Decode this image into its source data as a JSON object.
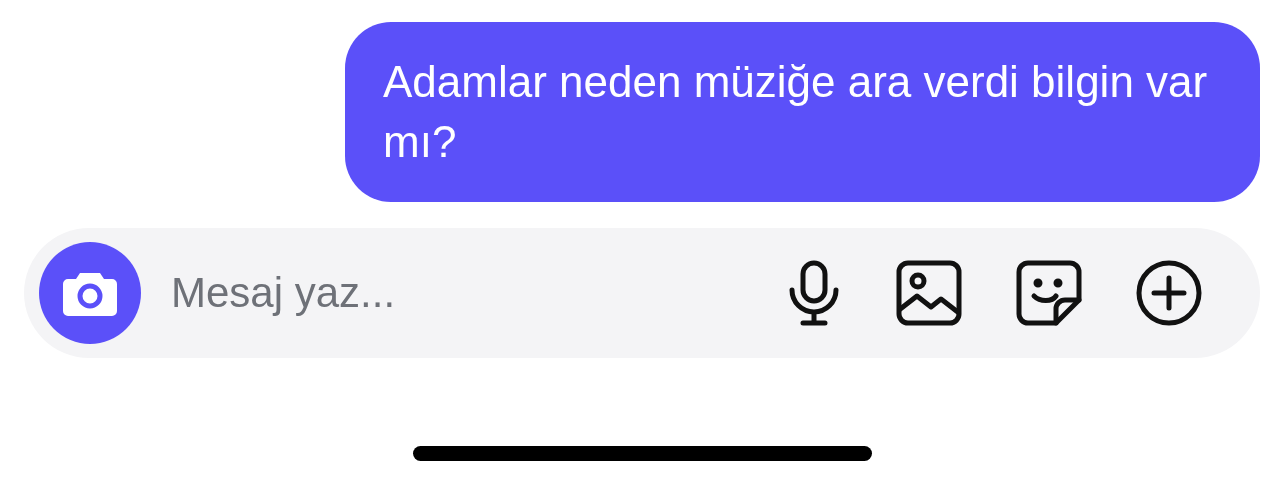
{
  "messages": [
    {
      "text": "Adamlar neden müziğe ara verdi bilgin var mı?"
    }
  ],
  "composer": {
    "placeholder": "Mesaj yaz..."
  }
}
